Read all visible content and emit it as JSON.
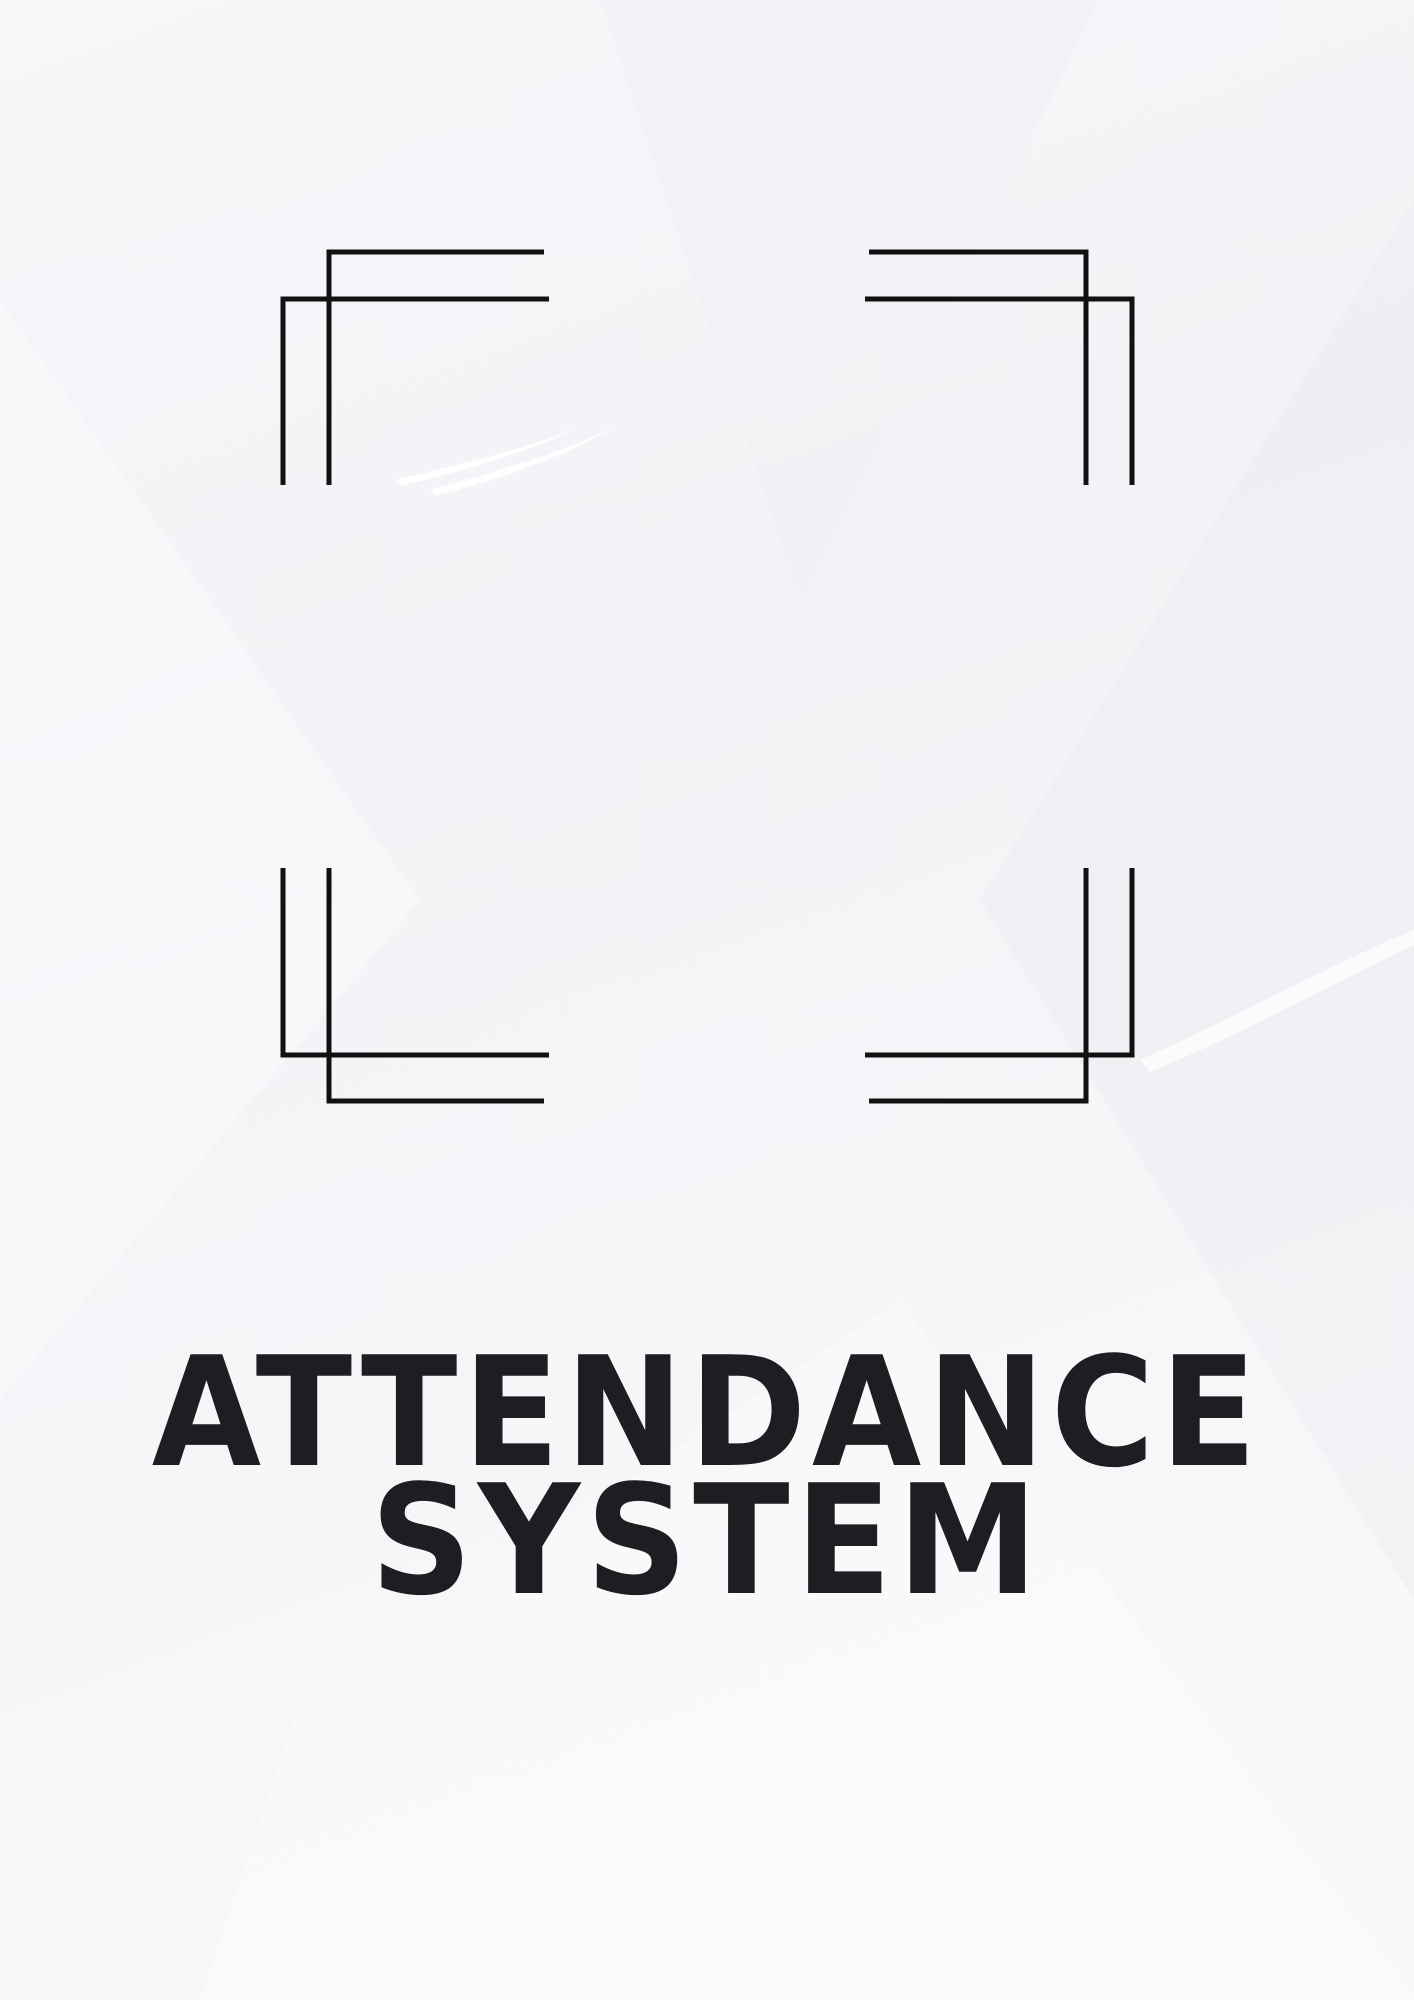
{
  "cover": {
    "title_line_1": "ATTENDANCE",
    "title_line_2": "SYSTEM"
  },
  "colors": {
    "background": "#f5f4f7",
    "ink": "#1e1e22",
    "frame_stroke": "#111111"
  },
  "decorations": {
    "frame_icon": "corner-bracket-frame-icon",
    "brush_icon": "white-brush-stroke-icon"
  }
}
